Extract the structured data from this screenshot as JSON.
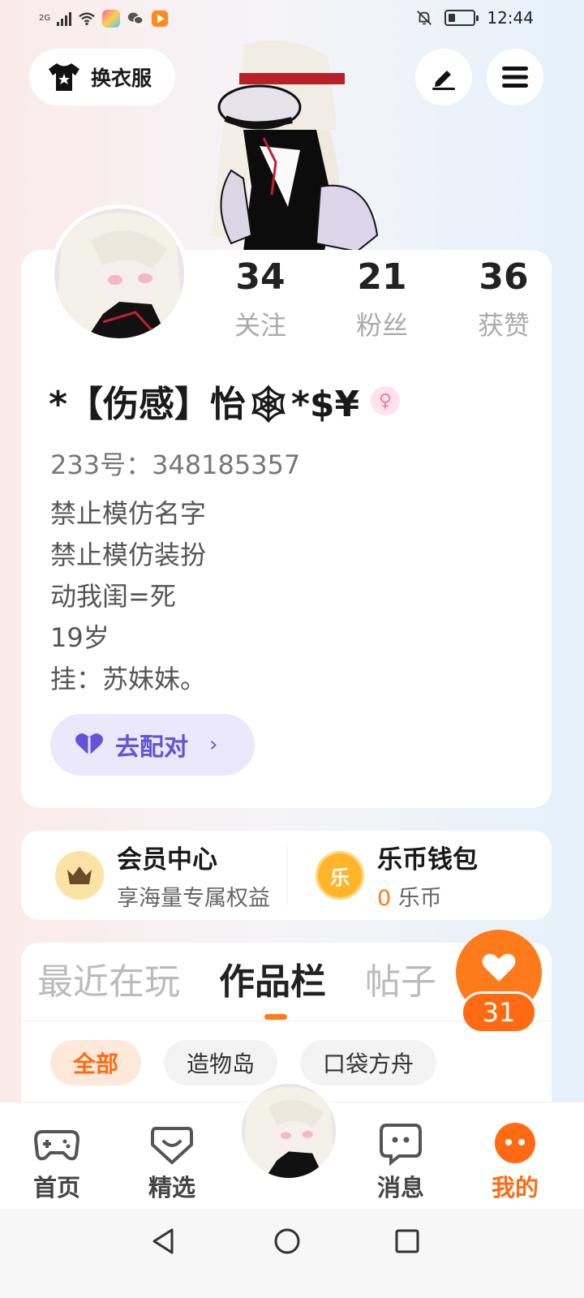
{
  "status_bar": {
    "signal_label": "2G",
    "time": "12:44"
  },
  "header": {
    "dress_up_label": "换衣服",
    "edit_icon": "pen-icon",
    "menu_icon": "hamburger-menu-icon"
  },
  "profile": {
    "stats": [
      {
        "value": "34",
        "label": "关注"
      },
      {
        "value": "21",
        "label": "粉丝"
      },
      {
        "value": "36",
        "label": "获赞"
      }
    ],
    "nickname": "*【伤感】怡🕸*$¥",
    "gender_symbol": "♀",
    "user_id": "233号：348185357",
    "bio_lines": [
      "禁止模仿名字",
      "禁止模仿装扮",
      "动我闺=死",
      "19岁",
      "挂：苏妹妹。"
    ],
    "match_button": "去配对",
    "match_arrow": "›"
  },
  "services": {
    "vip": {
      "title": "会员中心",
      "subtitle": "享海量专属权益",
      "icon": "crown-icon"
    },
    "wallet": {
      "title": "乐币钱包",
      "amount": "0",
      "unit": "乐币",
      "icon_text": "乐"
    }
  },
  "tabs": {
    "items": [
      {
        "label": "最近在玩"
      },
      {
        "label": "作品栏"
      },
      {
        "label": "帖子"
      }
    ],
    "active": "作品栏"
  },
  "filters": {
    "items": [
      {
        "label": "全部"
      },
      {
        "label": "造物岛"
      },
      {
        "label": "口袋方舟"
      }
    ]
  },
  "like_fab": {
    "count": "31",
    "icon": "heart-icon"
  },
  "bottom_nav": {
    "items": [
      {
        "label": "首页",
        "icon": "gamepad-icon"
      },
      {
        "label": "精选",
        "icon": "heart-chat-icon"
      },
      {
        "label": "消息",
        "icon": "message-icon"
      },
      {
        "label": "我的",
        "icon": "smile-face-icon"
      }
    ],
    "active": "我的"
  },
  "colors": {
    "accent": "#ff7a1a",
    "match_purple": "#6253d9"
  }
}
